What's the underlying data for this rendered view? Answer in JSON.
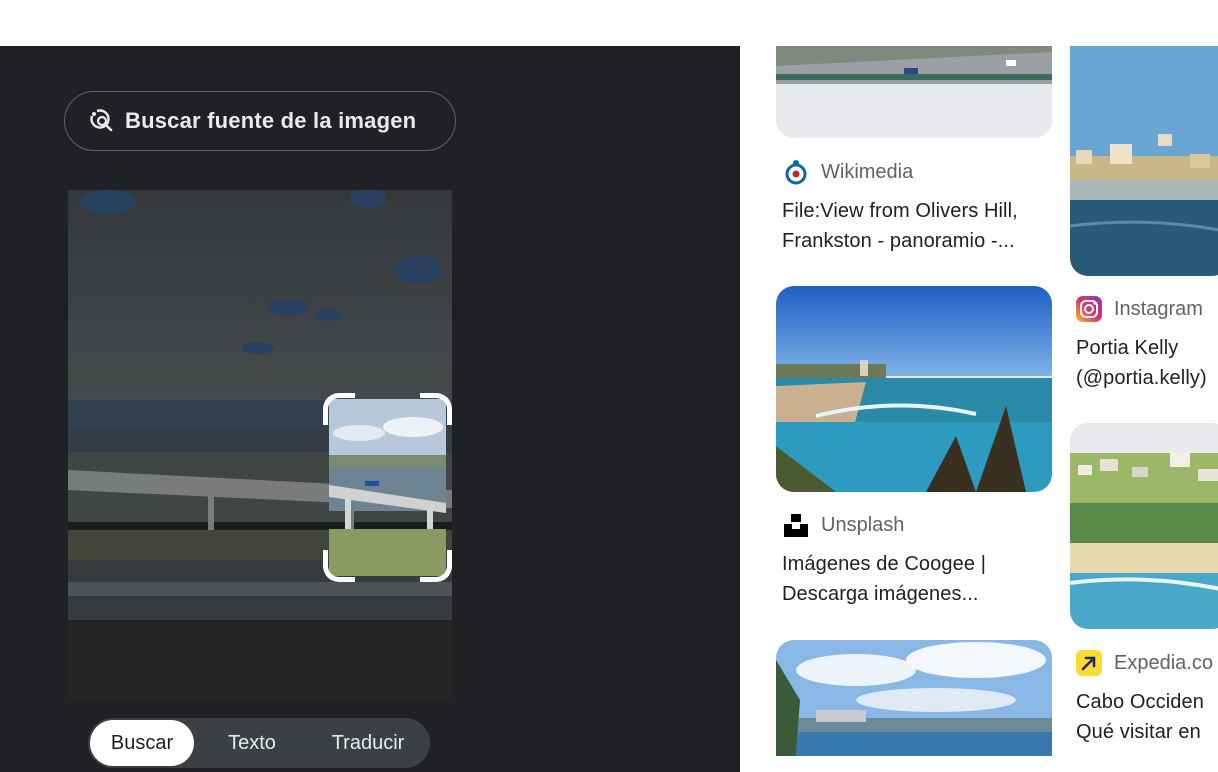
{
  "source_button": {
    "label": "Buscar fuente de la imagen",
    "icon": "image-search-icon"
  },
  "modes": [
    {
      "label": "Buscar",
      "active": true
    },
    {
      "label": "Texto",
      "active": false
    },
    {
      "label": "Traducir",
      "active": false
    }
  ],
  "results": {
    "col1": [
      {
        "source": "Wikimedia",
        "icon": "wikimedia-logo-icon",
        "title_line1": "File:View from Olivers Hill,",
        "title_line2": "Frankston - panoramio -..."
      },
      {
        "source": "Unsplash",
        "icon": "unsplash-logo-icon",
        "title_line1": "Imágenes de Coogee |",
        "title_line2": "Descarga imágenes..."
      }
    ],
    "col2": [
      {
        "source": "Instagram",
        "icon": "instagram-logo-icon",
        "title_line1": "Portia Kelly",
        "title_line2": "(@portia.kelly)"
      },
      {
        "source": "Expedia.co",
        "icon": "expedia-logo-icon",
        "title_line1": "Cabo Occiden",
        "title_line2": "Qué visitar en"
      }
    ]
  },
  "colors": {
    "panel_bg": "#202124",
    "mode_bg": "#3c4043",
    "text_dark": "#202124",
    "text_muted": "#5f6368"
  }
}
